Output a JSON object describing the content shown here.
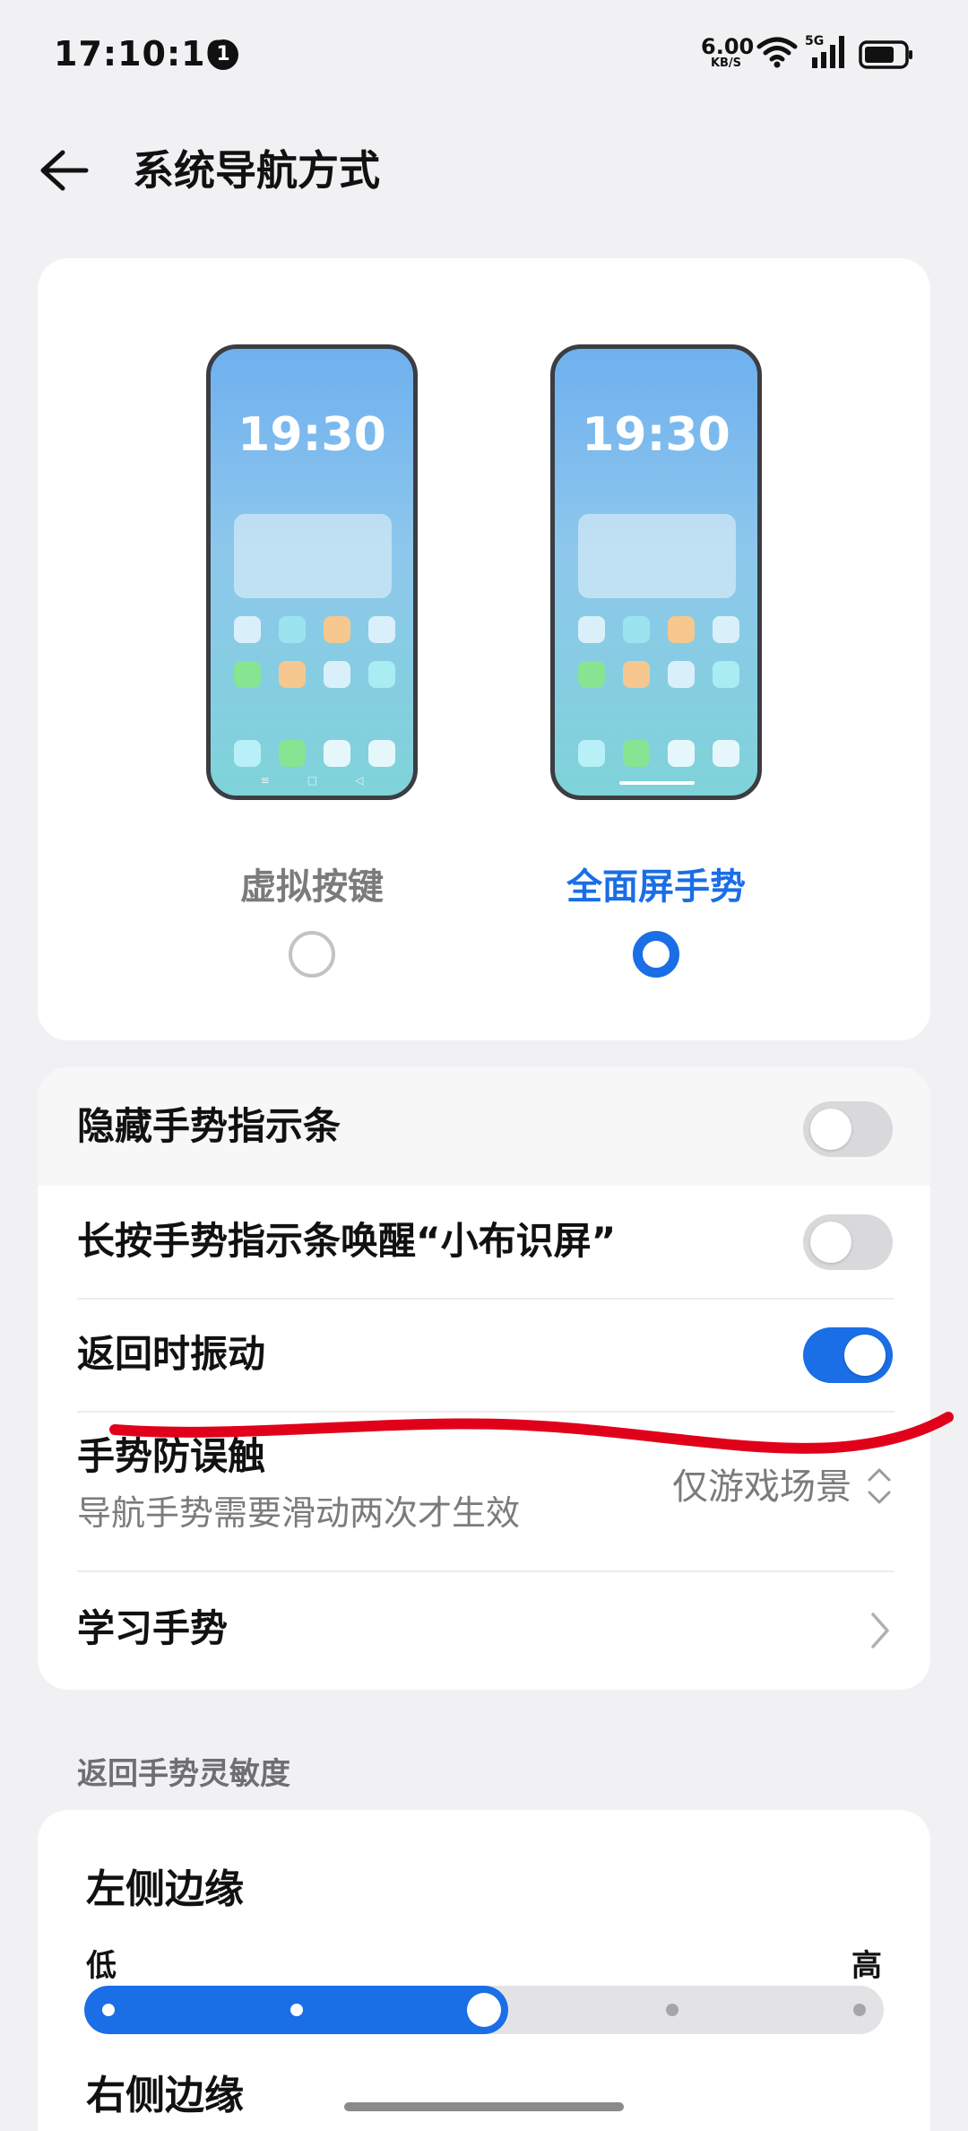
{
  "status_bar": {
    "time": "17:10:10",
    "notification_count": "1",
    "net_speed": "6.00",
    "net_speed_unit": "KB/S",
    "network_type": "5G",
    "icons": [
      "wifi-icon",
      "signal-icon",
      "battery-icon"
    ]
  },
  "header": {
    "title": "系统导航方式",
    "back_icon": "back-arrow-icon"
  },
  "preview": {
    "phone_clock": "19:30",
    "options": [
      {
        "label": "虚拟按键",
        "selected": false
      },
      {
        "label": "全面屏手势",
        "selected": true
      }
    ]
  },
  "settings": {
    "hide_bar": {
      "label": "隐藏手势指示条",
      "on": false
    },
    "long_press": {
      "label": "长按手势指示条唤醒“小布识屏”",
      "on": false
    },
    "vibrate": {
      "label": "返回时振动",
      "on": true
    },
    "anti_mistouch": {
      "label": "手势防误触",
      "sub": "导航手势需要滑动两次才生效",
      "value": "仅游戏场景"
    },
    "learn": {
      "label": "学习手势"
    }
  },
  "sensitivity": {
    "section_title": "返回手势灵敏度",
    "left_edge": {
      "label": "左侧边缘",
      "low": "低",
      "high": "高",
      "level_index": 2,
      "levels": 5
    },
    "right_edge": {
      "label": "右侧边缘"
    }
  },
  "colors": {
    "accent": "#1a6ee6",
    "background": "#f1f1f3",
    "annotation_stroke": "#e0001a"
  }
}
